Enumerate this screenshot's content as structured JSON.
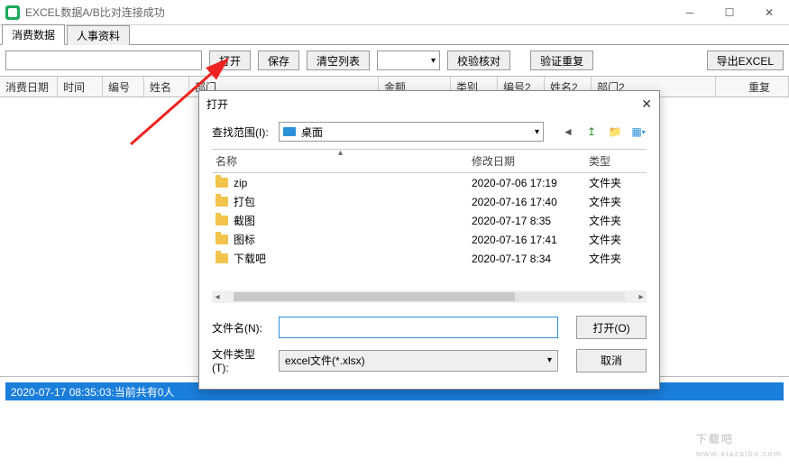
{
  "window": {
    "title": "EXCEL数据A/B比对连接成功"
  },
  "tabs": [
    {
      "label": "消费数据",
      "active": true
    },
    {
      "label": "人事资料",
      "active": false
    }
  ],
  "toolbar": {
    "search_value": "",
    "open": "打开",
    "save": "保存",
    "clear": "清空列表",
    "combo_value": "",
    "check": "校验核对",
    "verify": "验证重复",
    "export": "导出EXCEL"
  },
  "columns": [
    "消费日期",
    "时间",
    "编号",
    "姓名",
    "部门",
    "金额",
    "类别",
    "编号2",
    "姓名2",
    "部门2",
    "重复"
  ],
  "status": "2020-07-17 08:35:03:当前共有0人",
  "dialog": {
    "title": "打开",
    "lookin_label": "查找范围(I):",
    "lookin_value": "桌面",
    "headers": {
      "name": "名称",
      "date": "修改日期",
      "type": "类型"
    },
    "rows": [
      {
        "name": "zip",
        "date": "2020-07-06 17:19",
        "type": "文件夹"
      },
      {
        "name": "打包",
        "date": "2020-07-16 17:40",
        "type": "文件夹"
      },
      {
        "name": "截图",
        "date": "2020-07-17 8:35",
        "type": "文件夹"
      },
      {
        "name": "图标",
        "date": "2020-07-16 17:41",
        "type": "文件夹"
      },
      {
        "name": "下载吧",
        "date": "2020-07-17 8:34",
        "type": "文件夹"
      }
    ],
    "filename_label": "文件名(N):",
    "filename_value": "",
    "filetype_label": "文件类型(T):",
    "filetype_value": "excel文件(*.xlsx)",
    "open_btn": "打开(O)",
    "cancel_btn": "取消"
  },
  "watermark": {
    "main": "下载吧",
    "sub": "www.xiazaiba.com"
  }
}
